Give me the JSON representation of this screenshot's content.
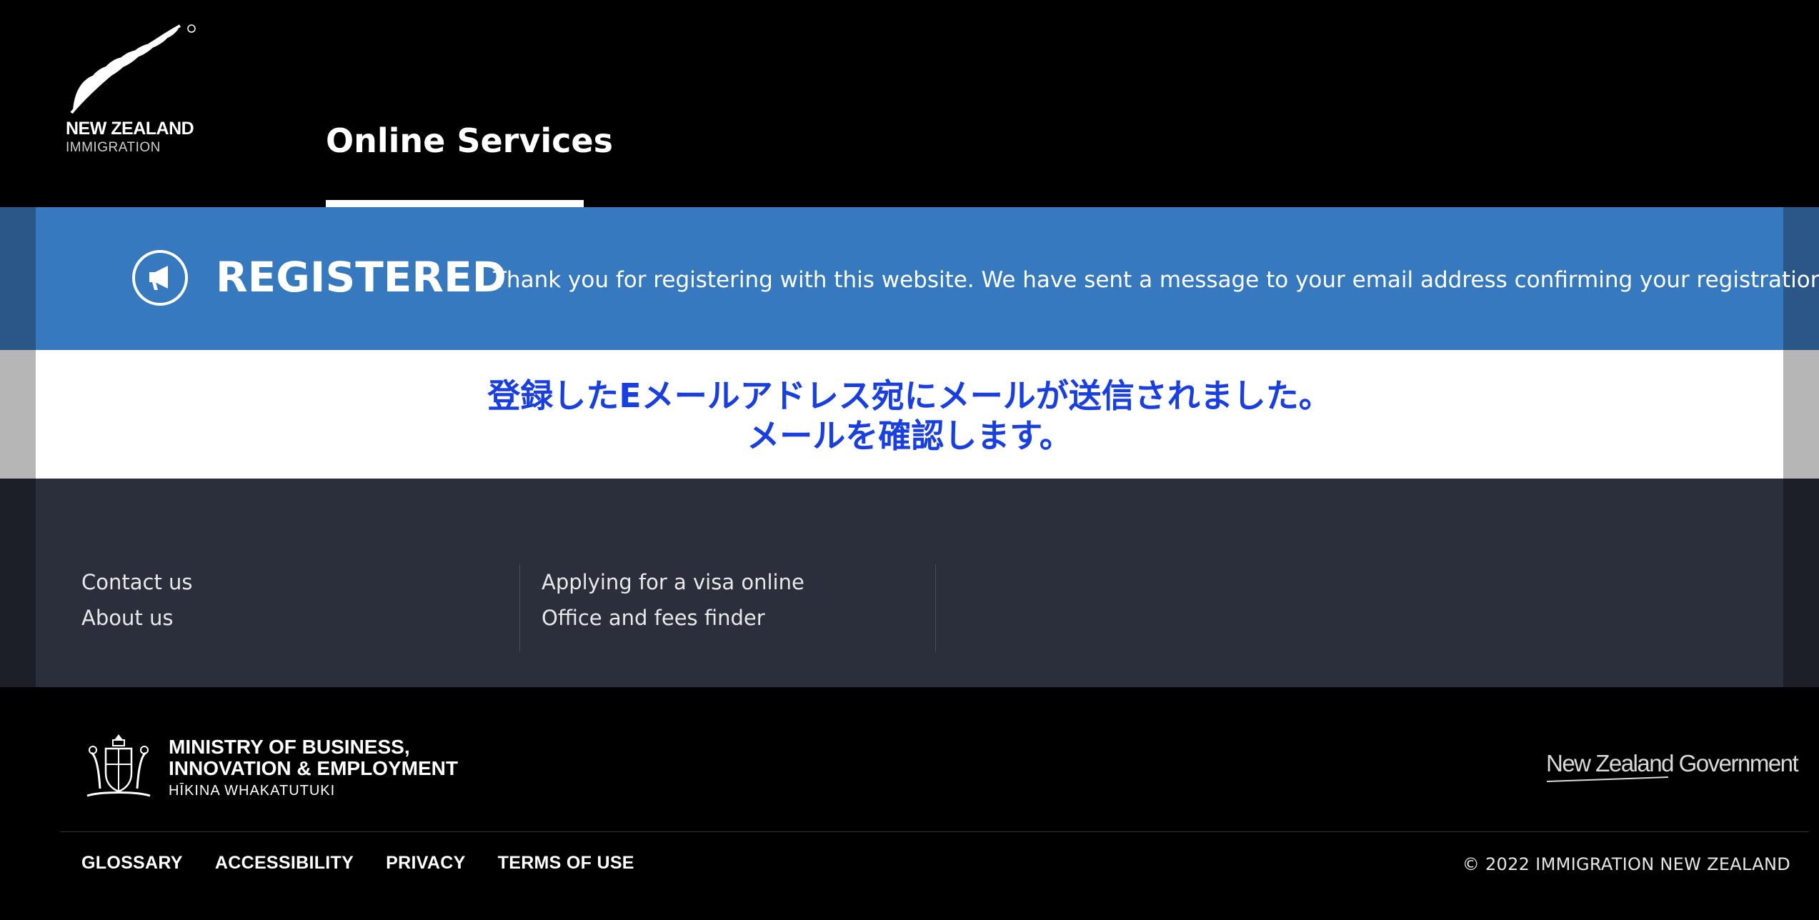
{
  "header": {
    "logo_line1": "NEW ZEALAND",
    "logo_line2": "IMMIGRATION",
    "site_tab": "Online Services"
  },
  "banner": {
    "icon": "megaphone-icon",
    "title": "REGISTERED",
    "message": "Thank you for registering with this website. We have sent a message to your email address confirming your registration.",
    "color": "#3679be"
  },
  "notice": {
    "line1": "登録したEメールアドレス宛にメールが送信されました。",
    "line2": "メールを確認します。",
    "color": "#1a3fe0"
  },
  "links": {
    "col1": [
      "Contact us",
      "About us"
    ],
    "col2": [
      "Applying for a visa online",
      "Office and fees finder"
    ]
  },
  "footer": {
    "mbie_line1": "MINISTRY OF BUSINESS,",
    "mbie_line2": "INNOVATION & EMPLOYMENT",
    "mbie_line3": "HĪKINA WHAKATUTUKI",
    "nzgov": "New Zealand Government",
    "links": [
      "GLOSSARY",
      "ACCESSIBILITY",
      "PRIVACY",
      "TERMS OF USE"
    ],
    "copyright": "© 2022 IMMIGRATION NEW ZEALAND"
  }
}
